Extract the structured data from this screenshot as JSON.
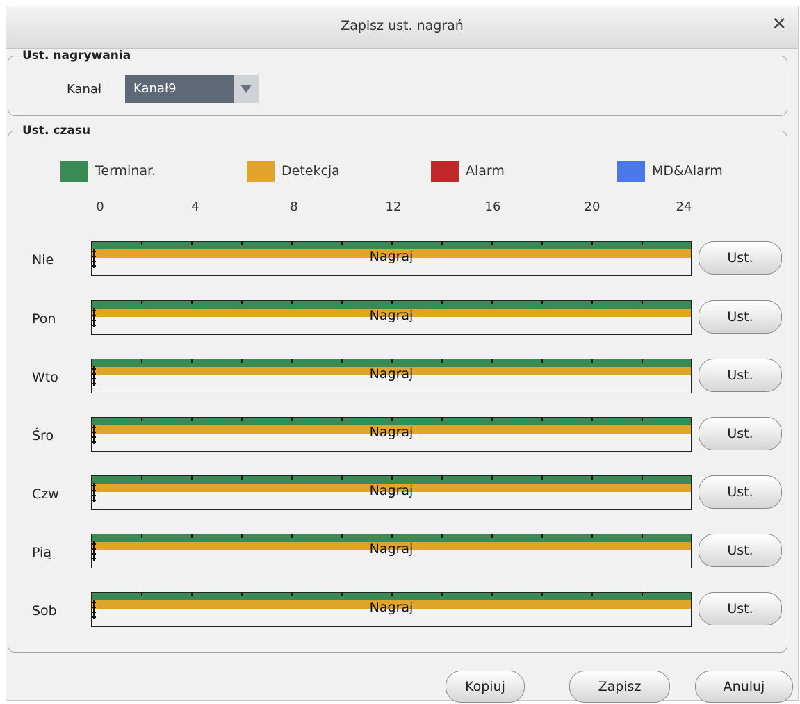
{
  "window": {
    "title": "Zapisz ust. nagrań",
    "close_icon": "close-icon"
  },
  "recording": {
    "legend": "Ust. nagrywania",
    "channel_label": "Kanał",
    "channel_value": "Kanał9"
  },
  "time": {
    "legend": "Ust. czasu",
    "legend_items": [
      {
        "label": "Terminar.",
        "color": "#3a8a55"
      },
      {
        "label": "Detekcja",
        "color": "#e0a42a"
      },
      {
        "label": "Alarm",
        "color": "#c0282a"
      },
      {
        "label": "MD&Alarm",
        "color": "#4a78e8"
      }
    ],
    "axis_labels": [
      "0",
      "4",
      "8",
      "12",
      "16",
      "20",
      "24"
    ],
    "rows": [
      {
        "day": "Nie",
        "bar_label": "Nagraj",
        "button": "Ust."
      },
      {
        "day": "Pon",
        "bar_label": "Nagraj",
        "button": "Ust."
      },
      {
        "day": "Wto",
        "bar_label": "Nagraj",
        "button": "Ust."
      },
      {
        "day": "Śro",
        "bar_label": "Nagraj",
        "button": "Ust."
      },
      {
        "day": "Czw",
        "bar_label": "Nagraj",
        "button": "Ust."
      },
      {
        "day": "Pią",
        "bar_label": "Nagraj",
        "button": "Ust."
      },
      {
        "day": "Sob",
        "bar_label": "Nagraj",
        "button": "Ust."
      }
    ]
  },
  "footer": {
    "copy": "Kopiuj",
    "save": "Zapisz",
    "cancel": "Anuluj"
  }
}
